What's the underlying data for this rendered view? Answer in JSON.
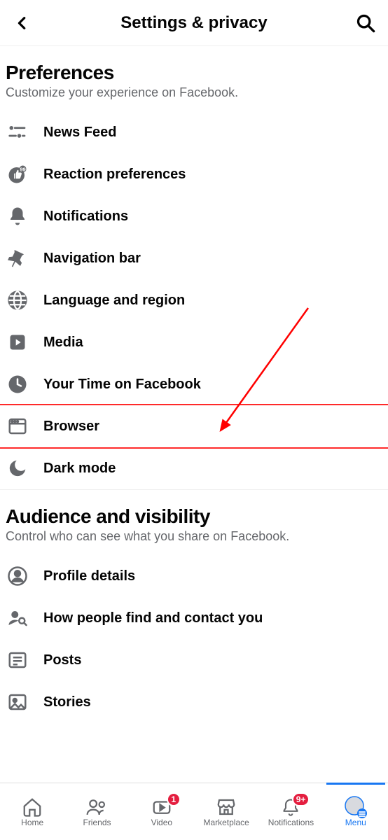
{
  "header": {
    "title": "Settings & privacy"
  },
  "sections": {
    "preferences": {
      "title": "Preferences",
      "subtitle": "Customize your experience on Facebook.",
      "items": [
        {
          "label": "News Feed"
        },
        {
          "label": "Reaction preferences"
        },
        {
          "label": "Notifications"
        },
        {
          "label": "Navigation bar"
        },
        {
          "label": "Language and region"
        },
        {
          "label": "Media"
        },
        {
          "label": "Your Time on Facebook"
        },
        {
          "label": "Browser"
        },
        {
          "label": "Dark mode"
        }
      ]
    },
    "audience": {
      "title": "Audience and visibility",
      "subtitle": "Control who can see what you share on Facebook.",
      "items": [
        {
          "label": "Profile details"
        },
        {
          "label": "How people find and contact you"
        },
        {
          "label": "Posts"
        },
        {
          "label": "Stories"
        }
      ]
    }
  },
  "tabs": {
    "items": [
      {
        "label": "Home",
        "badge": ""
      },
      {
        "label": "Friends",
        "badge": ""
      },
      {
        "label": "Video",
        "badge": "1"
      },
      {
        "label": "Marketplace",
        "badge": ""
      },
      {
        "label": "Notifications",
        "badge": "9+"
      },
      {
        "label": "Menu",
        "badge": ""
      }
    ]
  },
  "annotation": {
    "highlight_item": "Browser"
  }
}
